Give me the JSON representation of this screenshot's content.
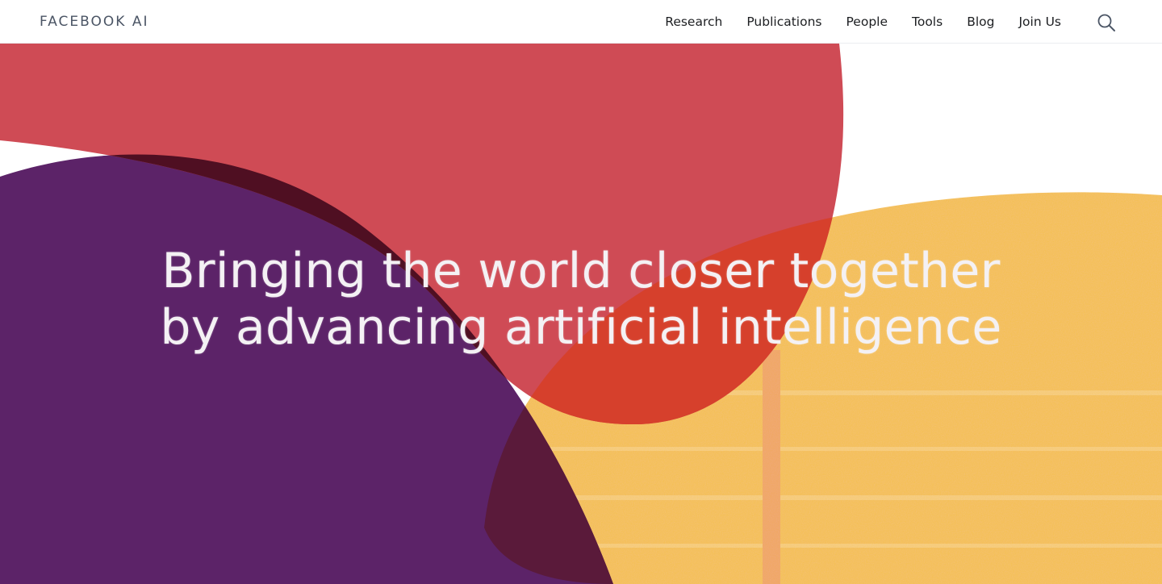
{
  "brand": {
    "name": "FACEBOOK AI"
  },
  "nav": {
    "items": [
      {
        "id": "research",
        "label": "Research"
      },
      {
        "id": "publications",
        "label": "Publications"
      },
      {
        "id": "people",
        "label": "People"
      },
      {
        "id": "tools",
        "label": "Tools"
      },
      {
        "id": "blog",
        "label": "Blog"
      },
      {
        "id": "join-us",
        "label": "Join Us"
      }
    ],
    "search_icon": "search-icon"
  },
  "hero": {
    "headline_line1": "Bringing the world closer together",
    "headline_line2": "by advancing artificial intelligence",
    "colors": {
      "red": "#cf4b55",
      "purple": "#5c2368",
      "dark_overlap": "#4f0f22",
      "yellow": "#f3c04a",
      "pink_texture": "#ef8fb8",
      "orange_overlap": "#d6402c"
    }
  }
}
